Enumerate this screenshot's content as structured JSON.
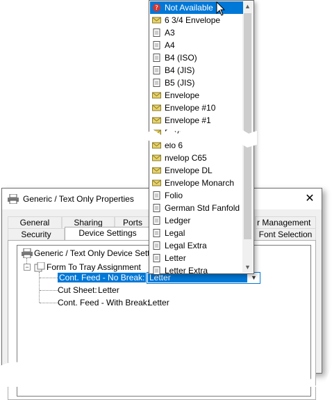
{
  "dialog": {
    "title": "Generic / Text Only Properties",
    "close_glyph": "✕",
    "tabs_row1": [
      "General",
      "Sharing",
      "Ports",
      "r Management"
    ],
    "tabs_row2": [
      "Security",
      "Device Settings",
      "Font Selection"
    ],
    "active_tab": "Device Settings"
  },
  "tree": {
    "root_label": "Generic / Text Only Device Setti",
    "group_label": "Form To Tray Assignment",
    "expander_glyph": "−",
    "items": [
      {
        "label": "Cont. Feed - No Break:",
        "value": "Letter"
      },
      {
        "label": "Cut Sheet:",
        "value": "Letter"
      },
      {
        "label": "Cont. Feed - With Break:",
        "value": "Letter"
      }
    ],
    "combo_arrow": "▼"
  },
  "dropdown": {
    "items": [
      {
        "label": "Not Available",
        "icon": "not-available-icon",
        "selected": true
      },
      {
        "label": "6 3/4 Envelope",
        "icon": "envelope-icon"
      },
      {
        "label": "A3",
        "icon": "page-icon"
      },
      {
        "label": "A4",
        "icon": "page-icon"
      },
      {
        "label": "B4 (ISO)",
        "icon": "page-icon"
      },
      {
        "label": "B4 (JIS)",
        "icon": "page-icon"
      },
      {
        "label": "B5 (JIS)",
        "icon": "page-icon"
      },
      {
        "label": "Envelope",
        "icon": "envelope-icon"
      },
      {
        "label": "Envelope #10",
        "icon": "envelope-icon"
      },
      {
        "label": "Envelope #1",
        "icon": "envelope-icon"
      },
      {
        "label": "Enve",
        "icon": "envelope-icon"
      },
      {
        "label": "elo  6",
        "icon": "envelope-icon"
      },
      {
        "label": "nvelop  C65",
        "icon": "envelope-icon"
      },
      {
        "label": "Envelope DL",
        "icon": "envelope-icon"
      },
      {
        "label": "Envelope Monarch",
        "icon": "envelope-icon"
      },
      {
        "label": "Folio",
        "icon": "page-icon"
      },
      {
        "label": "German Std Fanfold",
        "icon": "page-icon"
      },
      {
        "label": "Ledger",
        "icon": "page-icon"
      },
      {
        "label": "Legal",
        "icon": "page-icon"
      },
      {
        "label": "Legal Extra",
        "icon": "page-icon"
      },
      {
        "label": "Letter",
        "icon": "page-icon"
      },
      {
        "label": "Letter Extra",
        "icon": "page-icon"
      }
    ],
    "scroll_up": "▲",
    "scroll_down": "▼"
  },
  "colors": {
    "selection": "#0078d7",
    "envelope": "#e8d36a",
    "not_available": "#d9342b"
  }
}
